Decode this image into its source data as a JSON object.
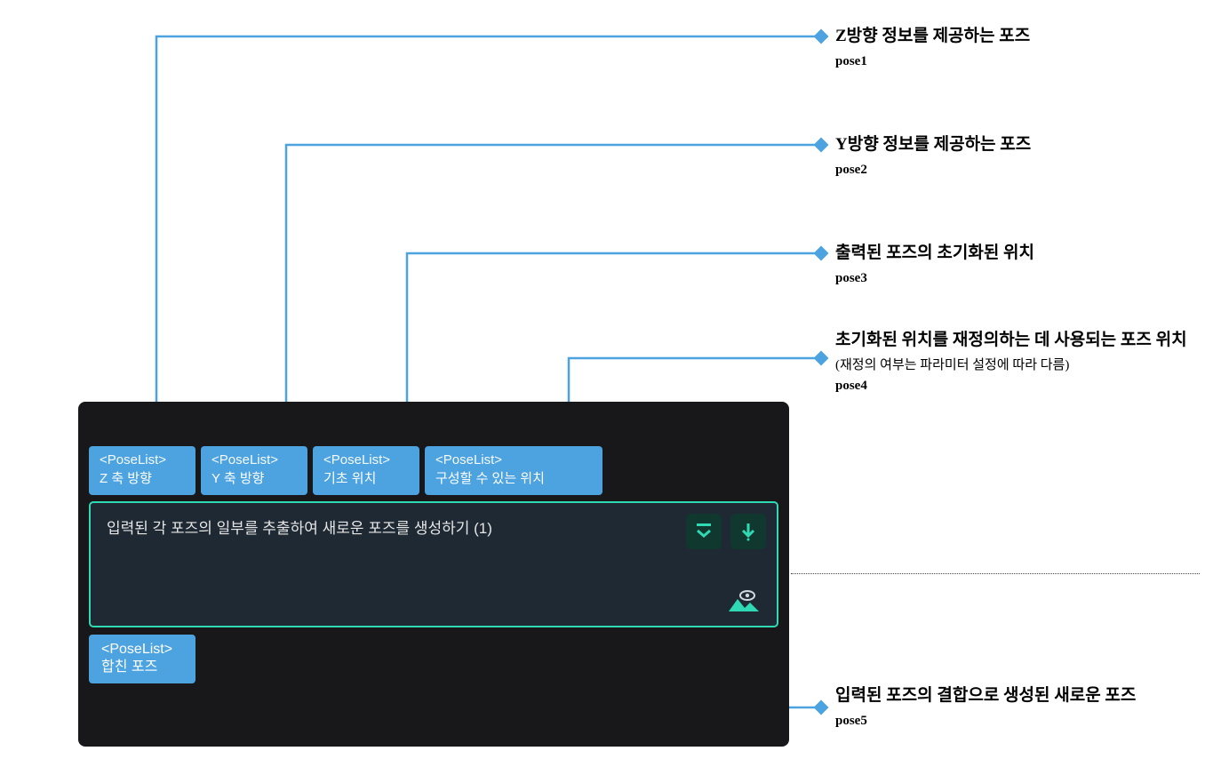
{
  "annotations": {
    "a1": {
      "title": "Z방향 정보를 제공하는 포즈",
      "code": "pose1"
    },
    "a2": {
      "title": "Y방향 정보를 제공하는 포즈",
      "code": "pose2"
    },
    "a3": {
      "title": "출력된 포즈의 초기화된 위치",
      "code": "pose3"
    },
    "a4": {
      "title": "초기화된 위치를 재정의하는 데 사용되는 포즈 위치",
      "subtitle": "(재정의 여부는 파라미터 설정에 따라 다름)",
      "code": "pose4"
    },
    "a5": {
      "title": "입력된 포즈의 결합으로 생성된 새로운 포즈",
      "code": "pose5"
    }
  },
  "node": {
    "title": "입력된 각 포즈의 일부를 추출하여 새로운 포즈를 생성하기 (1)"
  },
  "ports": {
    "type_label": "<PoseList>",
    "in1": "Z 축 방향",
    "in2": "Y 축 방향",
    "in3": "기초 위치",
    "in4": "구성할 수 있는 위치",
    "out1": "합친 포즈"
  }
}
